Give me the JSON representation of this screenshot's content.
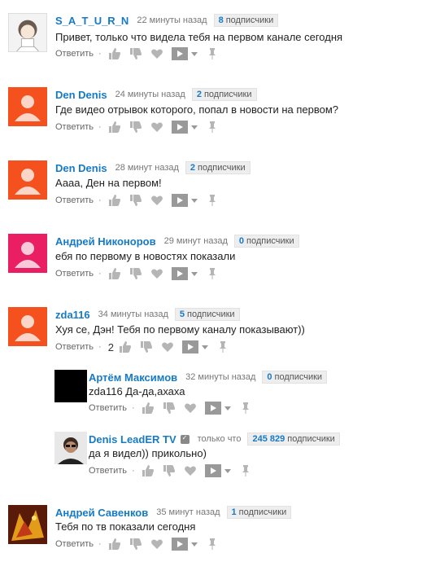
{
  "ui": {
    "reply_label": "Ответить",
    "dot": "·"
  },
  "comments": [
    {
      "author": "S_A_T_U_R_N",
      "time": "22 минуты назад",
      "subs_count": "8",
      "subs_label": "подписчики",
      "text": "Привет, только что видела тебя на первом канале сегодня"
    },
    {
      "author": "Den Denis",
      "time": "24 минуты назад",
      "subs_count": "2",
      "subs_label": "подписчики",
      "text": "Где видео отрывок которого, попал в новости на первом?"
    },
    {
      "author": "Den Denis",
      "time": "28 минут назад",
      "subs_count": "2",
      "subs_label": "подписчики",
      "text": "Аааа, Ден на первом!"
    },
    {
      "author": "Андрей Никоноров",
      "time": "29 минут назад",
      "subs_count": "0",
      "subs_label": "подписчики",
      "text": "ебя по первому в новостях показали"
    },
    {
      "author": "zda116",
      "time": "34 минуты назад",
      "subs_count": "5",
      "subs_label": "подписчики",
      "text": "Хуя се, Дэн! Тебя по первому каналу показывают))",
      "likes": "2"
    },
    {
      "author": "Артём Максимов",
      "time": "32 минуты назад",
      "subs_count": "0",
      "subs_label": "подписчики",
      "text": "zda116 Да-да,ахаха"
    },
    {
      "author": "Denis LeadER TV",
      "time": "только что",
      "subs_count": "245 829",
      "subs_label": "подписчики",
      "text": "да я видел)) прикольно)"
    },
    {
      "author": "Андрей Савенков",
      "time": "35 минут назад",
      "subs_count": "1",
      "subs_label": "подписчики",
      "text": "Тебя по тв показали сегодня"
    }
  ],
  "colors": {
    "link": "#167ac6",
    "default_avatar_orange": "#f4511e",
    "default_avatar_pink": "#e91e63"
  },
  "icons": [
    "thumb-up-icon",
    "thumb-down-icon",
    "heart-icon",
    "share-icon",
    "dropdown-caret-icon",
    "pin-icon"
  ]
}
